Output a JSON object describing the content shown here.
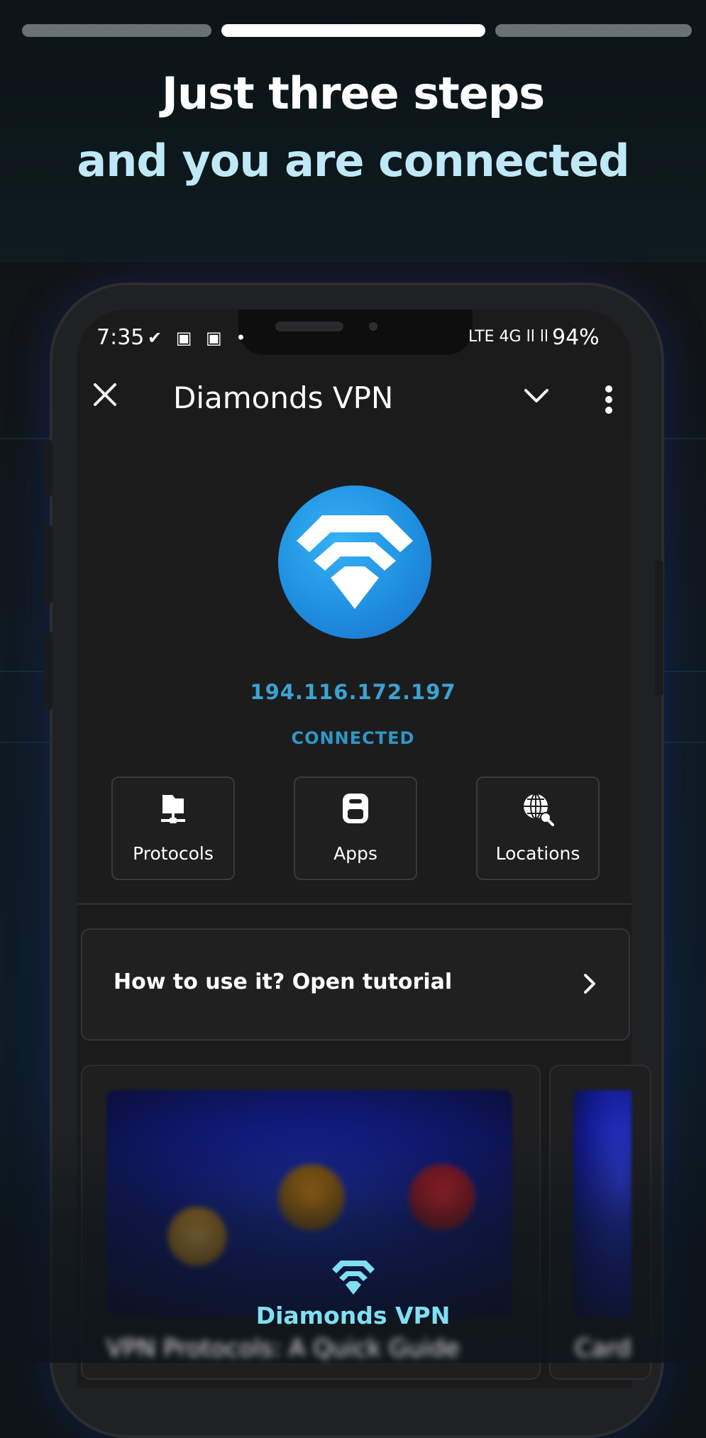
{
  "onboarding": {
    "step_current": 2,
    "step_total": 3,
    "headline_line1": "Just three steps",
    "headline_line2": "and you are connected"
  },
  "status_bar": {
    "time": "7:35",
    "left_icons": "✔ ▣ ▣ •",
    "right_icons": "LTE 4G ⅼⅼ ⅼⅼ",
    "battery": "94%"
  },
  "app_bar": {
    "title": "Diamonds VPN",
    "close_icon": "close-icon",
    "chevron_icon": "chevron-down-icon",
    "more_icon": "more-vertical-icon"
  },
  "connection": {
    "ip": "194.116.172.197",
    "status": "CONNECTED"
  },
  "tiles": [
    {
      "label": "Protocols",
      "icon": "protocols-icon"
    },
    {
      "label": "Apps",
      "icon": "apps-icon"
    },
    {
      "label": "Locations",
      "icon": "globe-search-icon"
    }
  ],
  "tutorial": {
    "label": "How to use it? Open tutorial"
  },
  "cards": {
    "card1_title": "VPN Protocols: A Quick Guide",
    "card2_title": "Card"
  },
  "footer": {
    "brand": "Diamonds VPN"
  },
  "colors": {
    "accent": "#3ba3d3",
    "brand": "#7fe0f4",
    "vpn_circle": "#1f8fe0"
  }
}
